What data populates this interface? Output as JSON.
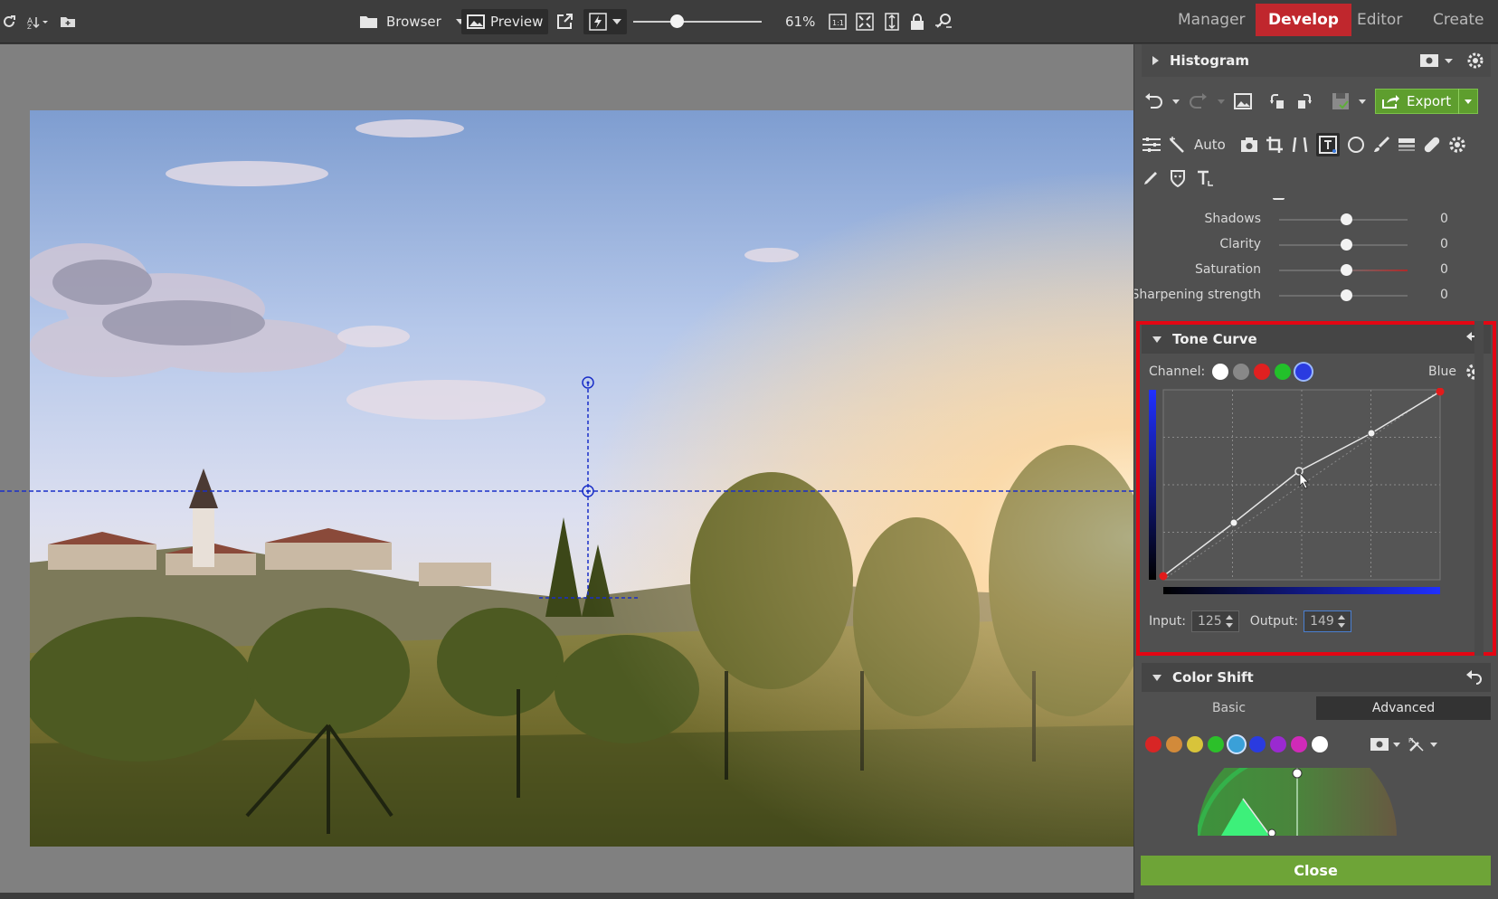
{
  "toolbar": {
    "browser_label": "Browser",
    "preview_label": "Preview",
    "zoom": "61%",
    "zoom_level": 0.35
  },
  "modes": {
    "manager": "Manager",
    "develop": "Develop",
    "editor": "Editor",
    "create": "Create"
  },
  "panel": {
    "histogram_title": "Histogram",
    "export_label": "Export",
    "auto_label": "Auto",
    "sliders": [
      {
        "label": "Shadows",
        "value": "0"
      },
      {
        "label": "Clarity",
        "value": "0"
      },
      {
        "label": "Saturation",
        "value": "0"
      },
      {
        "label": "Sharpening strength",
        "value": "0"
      }
    ],
    "tone_curve": {
      "title": "Tone Curve",
      "channel_label": "Channel:",
      "channel_selected": "Blue",
      "input_label": "Input:",
      "input_value": "125",
      "output_label": "Output:",
      "output_value": "149"
    },
    "color_shift": {
      "title": "Color Shift",
      "tab_basic": "Basic",
      "tab_advanced": "Advanced"
    },
    "close_label": "Close"
  },
  "colors": {
    "accent": "#c0272d",
    "highlight": "#e30613",
    "export_green": "#5e9e2e",
    "close_green": "#6ea437",
    "guide_blue": "#1a2fc8"
  }
}
